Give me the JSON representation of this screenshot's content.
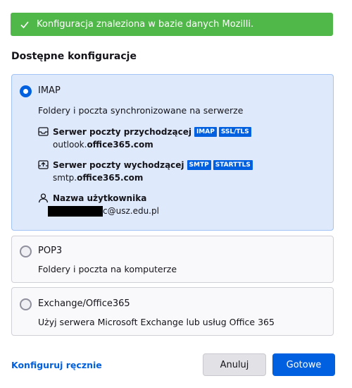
{
  "banner": {
    "text": "Konfiguracja znaleziona w bazie danych Mozilli."
  },
  "section_title": "Dostępne konfiguracje",
  "configs": [
    {
      "name": "IMAP",
      "description": "Foldery i poczta synchronizowane na serwerze",
      "selected": true,
      "incoming": {
        "label": "Serwer poczty przychodzącej",
        "tags": [
          "IMAP",
          "SSL/TLS"
        ],
        "host_prefix": "outlook.",
        "host_domain": "office365.com"
      },
      "outgoing": {
        "label": "Serwer poczty wychodzącej",
        "tags": [
          "SMTP",
          "STARTTLS"
        ],
        "host_prefix": "smtp.",
        "host_domain": "office365.com"
      },
      "username": {
        "label": "Nazwa użytkownika",
        "value_suffix": "c@usz.edu.pl"
      }
    },
    {
      "name": "POP3",
      "description": "Foldery i poczta na komputerze",
      "selected": false
    },
    {
      "name": "Exchange/Office365",
      "description": "Użyj serwera Microsoft Exchange lub usług Office 365",
      "selected": false
    }
  ],
  "footer": {
    "manual_link": "Konfiguruj ręcznie",
    "cancel": "Anuluj",
    "done": "Gotowe"
  },
  "icons": {
    "banner": "checkmark-icon",
    "incoming": "inbox-icon",
    "outgoing": "outbox-icon",
    "username": "user-icon"
  },
  "colors": {
    "success": "#50b848",
    "accent": "#0060df",
    "selected_bg": "#deeafc"
  }
}
